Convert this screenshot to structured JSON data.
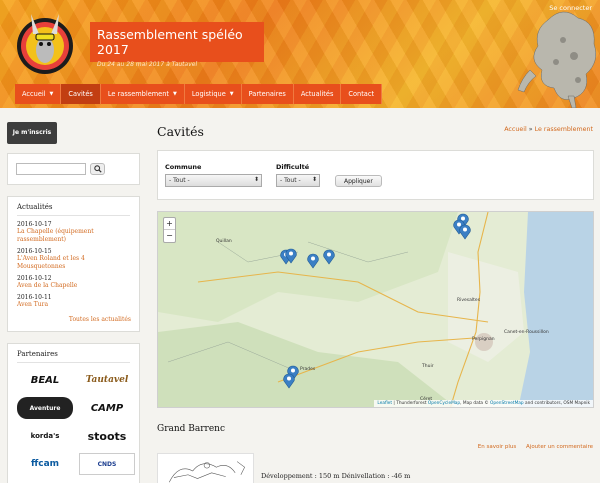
{
  "header": {
    "title": "Rassemblement spéléo 2017",
    "subtitle": "Du 24 au 28 mai 2017 à Tautavel",
    "login": "Se connecter"
  },
  "nav": [
    {
      "label": "Accueil",
      "caret": true,
      "active": false
    },
    {
      "label": "Cavités",
      "caret": false,
      "active": true
    },
    {
      "label": "Le rassemblement",
      "caret": true,
      "active": false
    },
    {
      "label": "Logistique",
      "caret": true,
      "active": false
    },
    {
      "label": "Partenaires",
      "caret": false,
      "active": false
    },
    {
      "label": "Actualités",
      "caret": false,
      "active": false
    },
    {
      "label": "Contact",
      "caret": false,
      "active": false
    }
  ],
  "sidebar": {
    "signup": "Je m'inscris",
    "search_placeholder": "",
    "news_title": "Actualités",
    "news": [
      {
        "date": "2016-10-17",
        "title": "La Chapelle (équipement rassemblement)"
      },
      {
        "date": "2016-10-15",
        "title": "L'Aven Roland et les 4 Mousquetonnes"
      },
      {
        "date": "2016-10-12",
        "title": "Aven de la Chapelle"
      },
      {
        "date": "2016-10-11",
        "title": "Aven Tura"
      }
    ],
    "news_all": "Toutes les actualités",
    "partners_title": "Partenaires",
    "partners": [
      "BEAL",
      "Tautavel",
      "Aventure",
      "CAMP",
      "korda's",
      "stoots",
      "ffcam",
      "CNDS"
    ]
  },
  "main": {
    "title": "Cavités",
    "breadcrumb": {
      "home": "Accueil",
      "sep": "»",
      "current": "Le rassemblement"
    },
    "filters": {
      "commune_label": "Commune",
      "commune_value": "- Tout -",
      "difficulte_label": "Difficulté",
      "difficulte_value": "- Tout -",
      "apply": "Appliquer"
    },
    "map": {
      "zoom_in": "+",
      "zoom_out": "−",
      "attribution_leaflet": "Leaflet",
      "attribution_mid": " | Thunderforest ",
      "attribution_ocm": "OpenCycleMap",
      "attribution_data": ", Map data © ",
      "attribution_osm": "OpenStreetMap",
      "attribution_end": " and contributors, OSM Mapnik",
      "labels": [
        "Quillan",
        "Rivesaltes",
        "Perpignan",
        "Canet-en-Roussillon",
        "Thuir",
        "Prades",
        "Céret"
      ],
      "marker_count": 9,
      "marker_color": "#3b7fc4"
    },
    "cave": {
      "name": "Grand Barrenc",
      "link_more": "En savoir plus",
      "link_comment": "Ajouter un commentaire",
      "stats": "Développement : 150 m Dénivellation : -46 m"
    }
  },
  "colors": {
    "accent": "#e84f1c",
    "link": "#d2691e",
    "dark_button": "#3d3d3d"
  }
}
